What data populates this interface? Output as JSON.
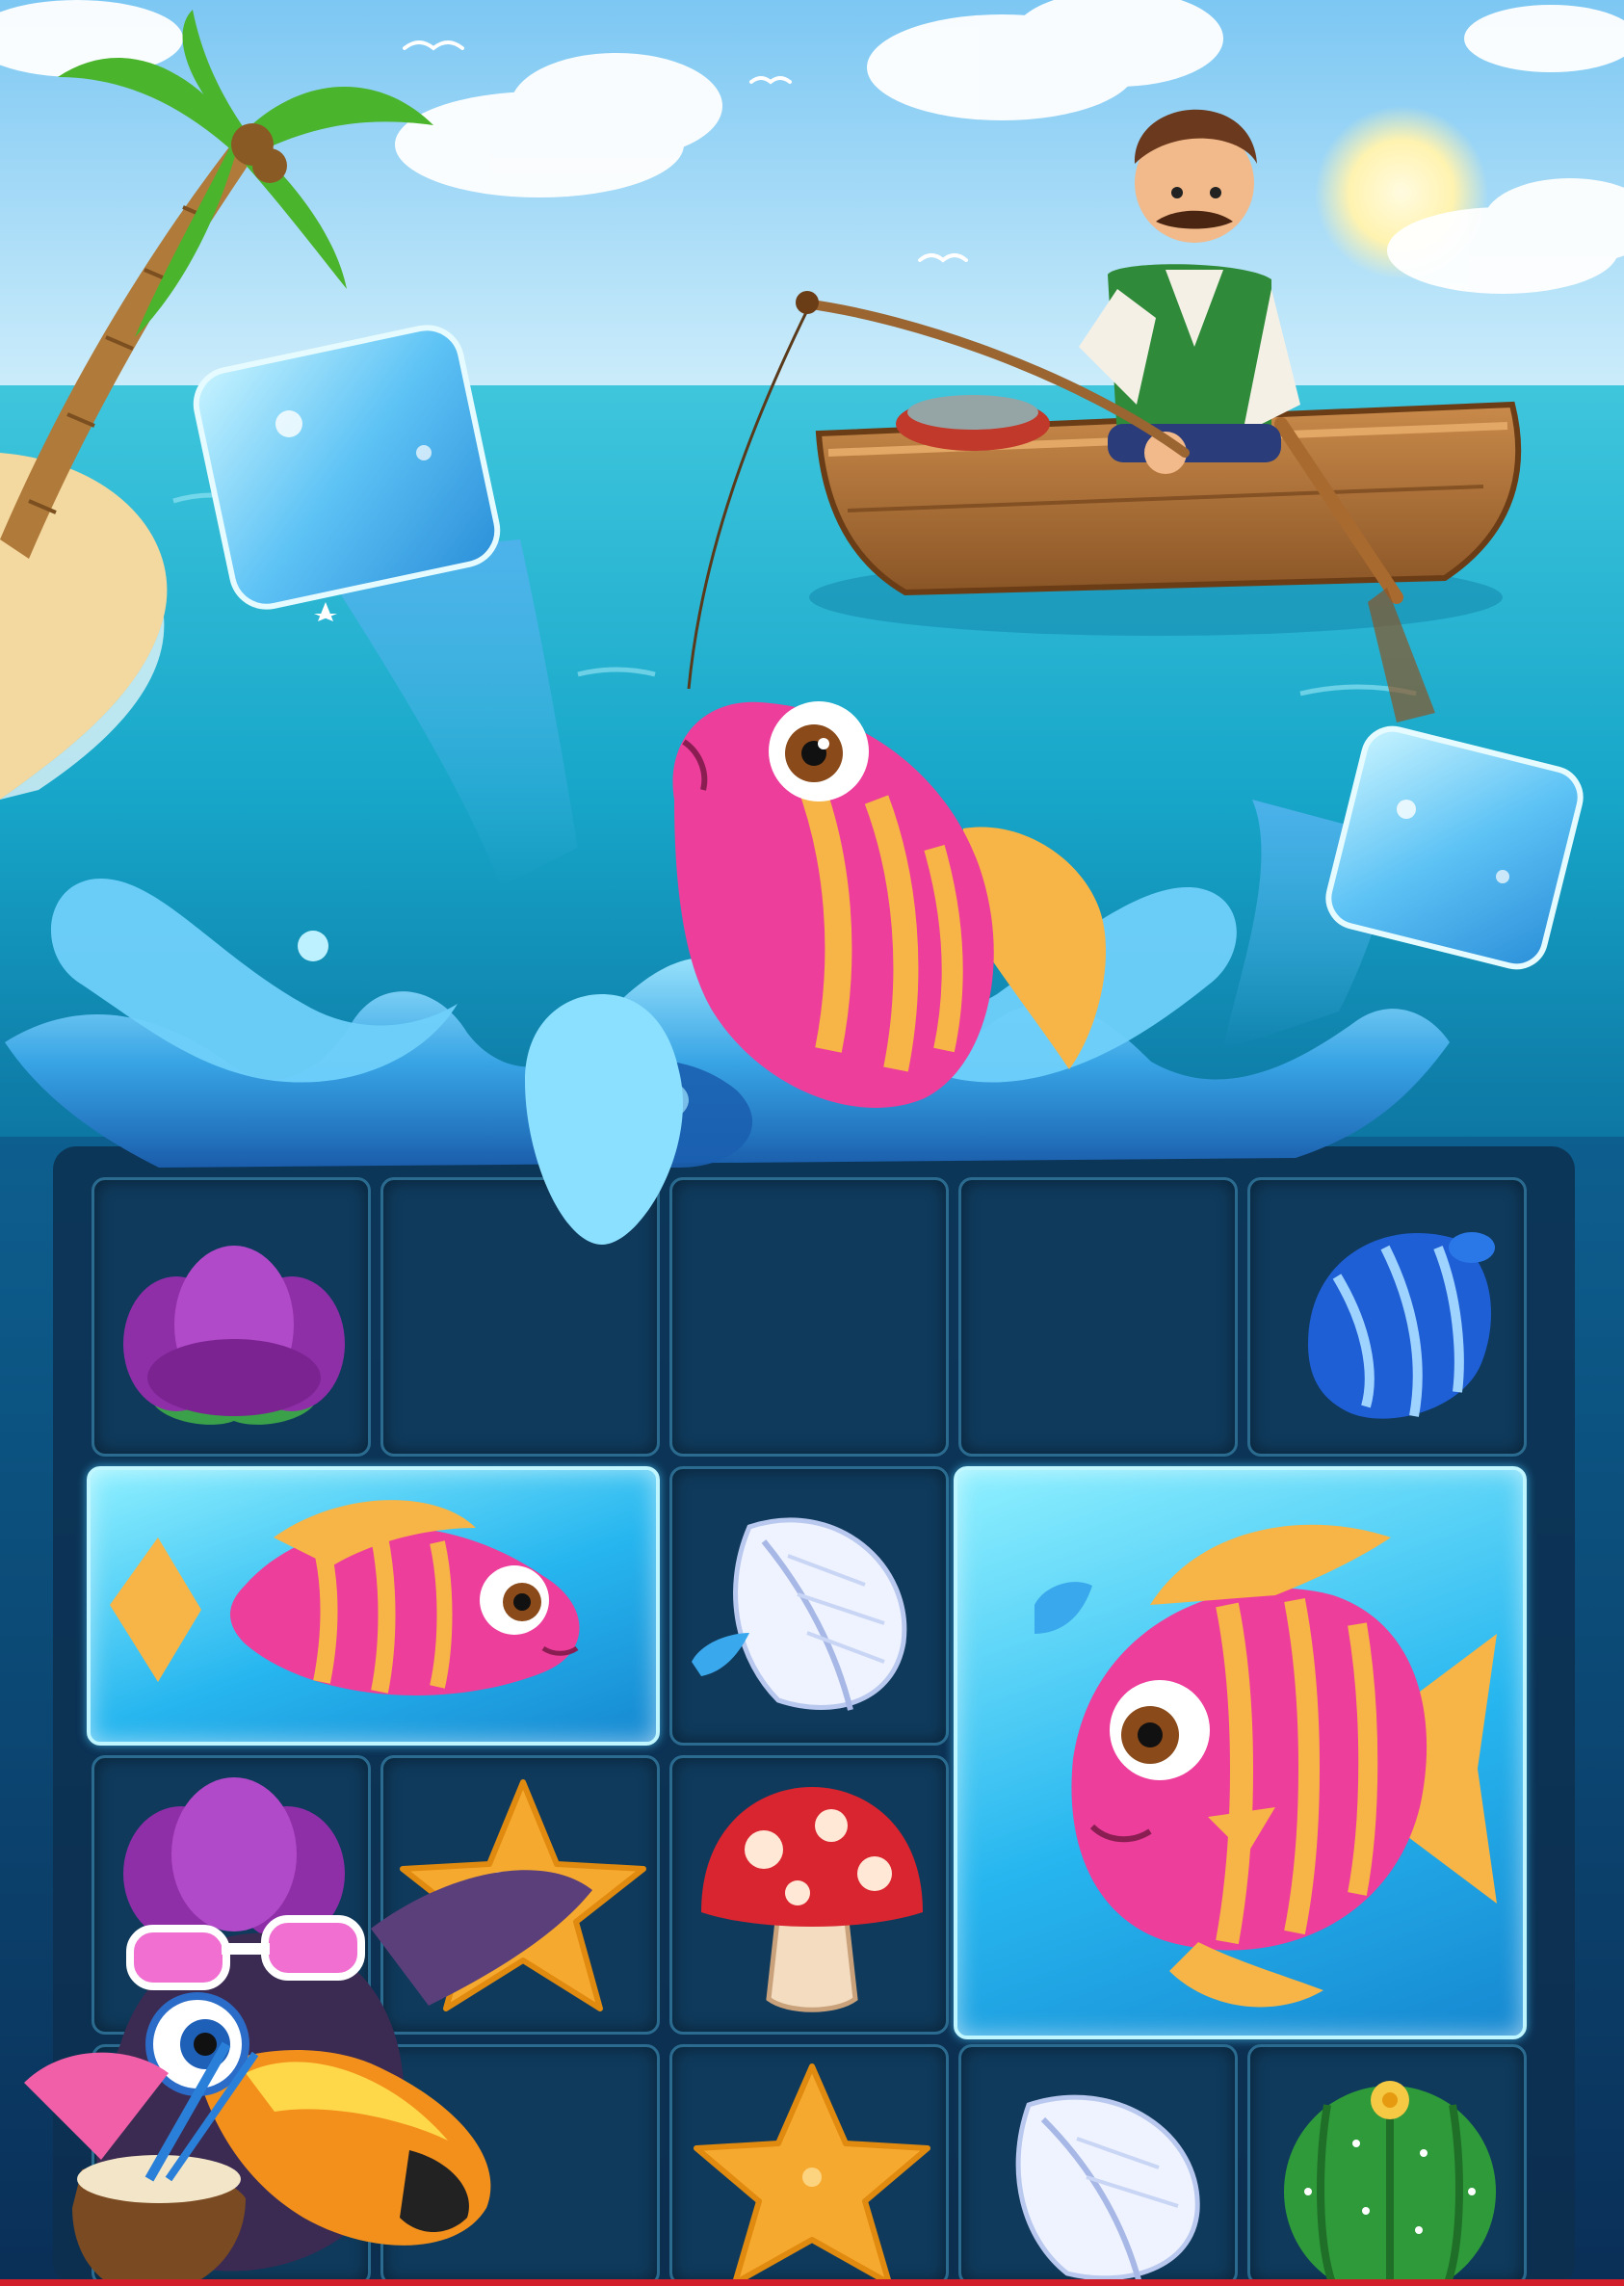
{
  "game": {
    "scene": "fishing-match3-promo",
    "colors": {
      "sky": "#8fd3f7",
      "sea": "#1fb5d6",
      "board": "#0f3a5c",
      "ice": "#39c2f2",
      "fish_pink": "#ec3e9a",
      "fish_stripe": "#f7b447"
    },
    "characters": [
      "fisherman-in-boat",
      "pink-fish-on-hook",
      "toucan-with-sunglasses"
    ],
    "board": {
      "columns": 5,
      "rows": 4,
      "tiles": [
        [
          "coral-flower",
          "splash",
          "splash",
          "splash",
          "blue-shell"
        ],
        [
          "pink-fish",
          "pink-fish",
          "white-feather",
          "big-pink-fish",
          "big-pink-fish"
        ],
        [
          "coral-flower",
          "starfish",
          "red-mushroom",
          "big-pink-fish",
          "big-pink-fish"
        ],
        [
          "toucan",
          "toucan",
          "starfish",
          "white-feather",
          "green-cactus"
        ]
      ]
    }
  }
}
